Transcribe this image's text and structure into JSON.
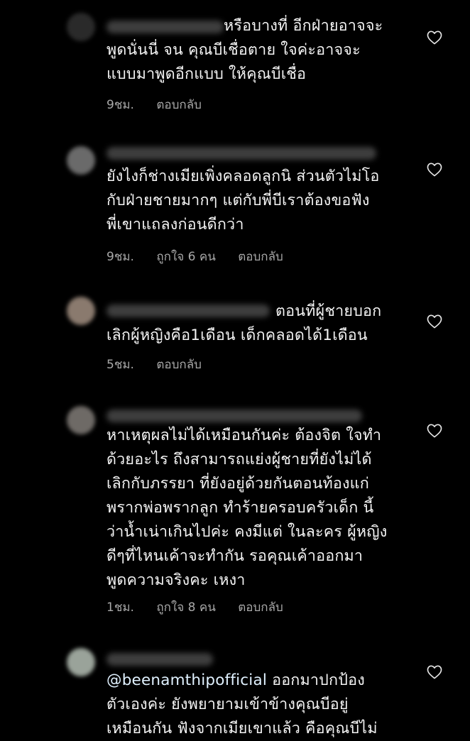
{
  "comments": [
    {
      "text_first": "หรือบางที่ อีกฝ่ายอาจจะ",
      "text_rest": "พูดนั่นนี่ จน คุณบีเชื่อตาย ใจค่ะอาจจะ\nแบบมาพูดอีกแบบ ให้คุณบีเชื่อ",
      "time": "9ชม.",
      "likes": "",
      "reply": "ตอบกลับ"
    },
    {
      "text_first": "",
      "text_rest": "ยังไงก็ช่างเมียเพิ่งคลอดลูกนิ ส่วนตัวไม่โอ\nกับฝ่ายชายมากๆ แต่กับพี่บีเราต้องขอฟัง\nพี่เขาแถลงก่อนดีกว่า",
      "time": "9ชม.",
      "likes": "ถูกใจ 6 คน",
      "reply": "ตอบกลับ"
    },
    {
      "text_first": "ตอนที่ผู้ชายบอก",
      "text_rest": "เลิกผู้หญิงคือ1เดือน เด็กคลอดได้1เดือน",
      "time": "5ชม.",
      "likes": "",
      "reply": "ตอบกลับ"
    },
    {
      "text_first": "",
      "text_rest": "หาเหตุผลไม่ได้เหมือนกันค่ะ ต้องจิต ใจทำ\nด้วยอะไร ถึงสามารถแย่งผู้ชายที่ยังไม่ได้\nเลิกกับภรรยา ที่ยังอยู่ด้วยกันตอนท้องแก่\nพรากพ่อพรากลูก ทำร้ายครอบครัวเด็ก นี้\nว่าน้ำเน่าเกินไปค่ะ คงมีแต่ ในละคร ผู้หญิง\nดีๆที่ไหนเค้าจะทำกัน รอคุณเค้าออกมา\nพูดความจริงคะ เหงา",
      "time": "1ชม.",
      "likes": "ถูกใจ 8 คน",
      "reply": "ตอบกลับ"
    },
    {
      "mention": "@beenamthipofficial",
      "text_first": " ออกมาปกป้อง",
      "text_rest": "ตัวเองค่ะ ยังพยายามเข้าข้างคุณบีอยู่\nเหมือนกัน ฟังจากเมียเขาแล้ว คือคุณบีไม่",
      "time": "",
      "likes": "",
      "reply": ""
    }
  ],
  "icons": {
    "like": "heart-outline-icon"
  },
  "colors": {
    "background": "#000000",
    "text": "#f4f4f4",
    "meta": "#a8a8a8"
  }
}
